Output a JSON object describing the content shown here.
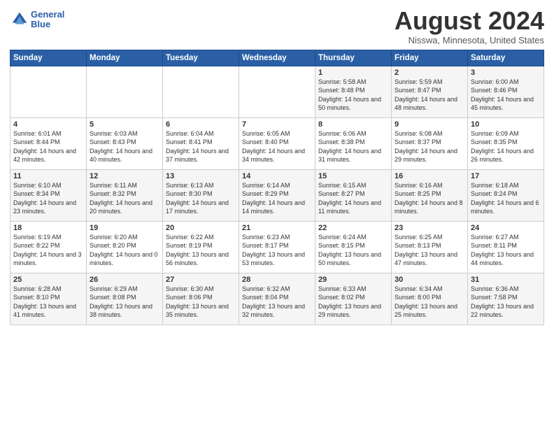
{
  "logo": {
    "line1": "General",
    "line2": "Blue"
  },
  "title": "August 2024",
  "location": "Nisswa, Minnesota, United States",
  "days_of_week": [
    "Sunday",
    "Monday",
    "Tuesday",
    "Wednesday",
    "Thursday",
    "Friday",
    "Saturday"
  ],
  "weeks": [
    [
      {
        "day": "",
        "info": ""
      },
      {
        "day": "",
        "info": ""
      },
      {
        "day": "",
        "info": ""
      },
      {
        "day": "",
        "info": ""
      },
      {
        "day": "1",
        "info": "Sunrise: 5:58 AM\nSunset: 8:48 PM\nDaylight: 14 hours\nand 50 minutes."
      },
      {
        "day": "2",
        "info": "Sunrise: 5:59 AM\nSunset: 8:47 PM\nDaylight: 14 hours\nand 48 minutes."
      },
      {
        "day": "3",
        "info": "Sunrise: 6:00 AM\nSunset: 8:46 PM\nDaylight: 14 hours\nand 45 minutes."
      }
    ],
    [
      {
        "day": "4",
        "info": "Sunrise: 6:01 AM\nSunset: 8:44 PM\nDaylight: 14 hours\nand 42 minutes."
      },
      {
        "day": "5",
        "info": "Sunrise: 6:03 AM\nSunset: 8:43 PM\nDaylight: 14 hours\nand 40 minutes."
      },
      {
        "day": "6",
        "info": "Sunrise: 6:04 AM\nSunset: 8:41 PM\nDaylight: 14 hours\nand 37 minutes."
      },
      {
        "day": "7",
        "info": "Sunrise: 6:05 AM\nSunset: 8:40 PM\nDaylight: 14 hours\nand 34 minutes."
      },
      {
        "day": "8",
        "info": "Sunrise: 6:06 AM\nSunset: 8:38 PM\nDaylight: 14 hours\nand 31 minutes."
      },
      {
        "day": "9",
        "info": "Sunrise: 6:08 AM\nSunset: 8:37 PM\nDaylight: 14 hours\nand 29 minutes."
      },
      {
        "day": "10",
        "info": "Sunrise: 6:09 AM\nSunset: 8:35 PM\nDaylight: 14 hours\nand 26 minutes."
      }
    ],
    [
      {
        "day": "11",
        "info": "Sunrise: 6:10 AM\nSunset: 8:34 PM\nDaylight: 14 hours\nand 23 minutes."
      },
      {
        "day": "12",
        "info": "Sunrise: 6:11 AM\nSunset: 8:32 PM\nDaylight: 14 hours\nand 20 minutes."
      },
      {
        "day": "13",
        "info": "Sunrise: 6:13 AM\nSunset: 8:30 PM\nDaylight: 14 hours\nand 17 minutes."
      },
      {
        "day": "14",
        "info": "Sunrise: 6:14 AM\nSunset: 8:29 PM\nDaylight: 14 hours\nand 14 minutes."
      },
      {
        "day": "15",
        "info": "Sunrise: 6:15 AM\nSunset: 8:27 PM\nDaylight: 14 hours\nand 11 minutes."
      },
      {
        "day": "16",
        "info": "Sunrise: 6:16 AM\nSunset: 8:25 PM\nDaylight: 14 hours\nand 8 minutes."
      },
      {
        "day": "17",
        "info": "Sunrise: 6:18 AM\nSunset: 8:24 PM\nDaylight: 14 hours\nand 6 minutes."
      }
    ],
    [
      {
        "day": "18",
        "info": "Sunrise: 6:19 AM\nSunset: 8:22 PM\nDaylight: 14 hours\nand 3 minutes."
      },
      {
        "day": "19",
        "info": "Sunrise: 6:20 AM\nSunset: 8:20 PM\nDaylight: 14 hours\nand 0 minutes."
      },
      {
        "day": "20",
        "info": "Sunrise: 6:22 AM\nSunset: 8:19 PM\nDaylight: 13 hours\nand 56 minutes."
      },
      {
        "day": "21",
        "info": "Sunrise: 6:23 AM\nSunset: 8:17 PM\nDaylight: 13 hours\nand 53 minutes."
      },
      {
        "day": "22",
        "info": "Sunrise: 6:24 AM\nSunset: 8:15 PM\nDaylight: 13 hours\nand 50 minutes."
      },
      {
        "day": "23",
        "info": "Sunrise: 6:25 AM\nSunset: 8:13 PM\nDaylight: 13 hours\nand 47 minutes."
      },
      {
        "day": "24",
        "info": "Sunrise: 6:27 AM\nSunset: 8:11 PM\nDaylight: 13 hours\nand 44 minutes."
      }
    ],
    [
      {
        "day": "25",
        "info": "Sunrise: 6:28 AM\nSunset: 8:10 PM\nDaylight: 13 hours\nand 41 minutes."
      },
      {
        "day": "26",
        "info": "Sunrise: 6:29 AM\nSunset: 8:08 PM\nDaylight: 13 hours\nand 38 minutes."
      },
      {
        "day": "27",
        "info": "Sunrise: 6:30 AM\nSunset: 8:06 PM\nDaylight: 13 hours\nand 35 minutes."
      },
      {
        "day": "28",
        "info": "Sunrise: 6:32 AM\nSunset: 8:04 PM\nDaylight: 13 hours\nand 32 minutes."
      },
      {
        "day": "29",
        "info": "Sunrise: 6:33 AM\nSunset: 8:02 PM\nDaylight: 13 hours\nand 29 minutes."
      },
      {
        "day": "30",
        "info": "Sunrise: 6:34 AM\nSunset: 8:00 PM\nDaylight: 13 hours\nand 25 minutes."
      },
      {
        "day": "31",
        "info": "Sunrise: 6:36 AM\nSunset: 7:58 PM\nDaylight: 13 hours\nand 22 minutes."
      }
    ]
  ]
}
